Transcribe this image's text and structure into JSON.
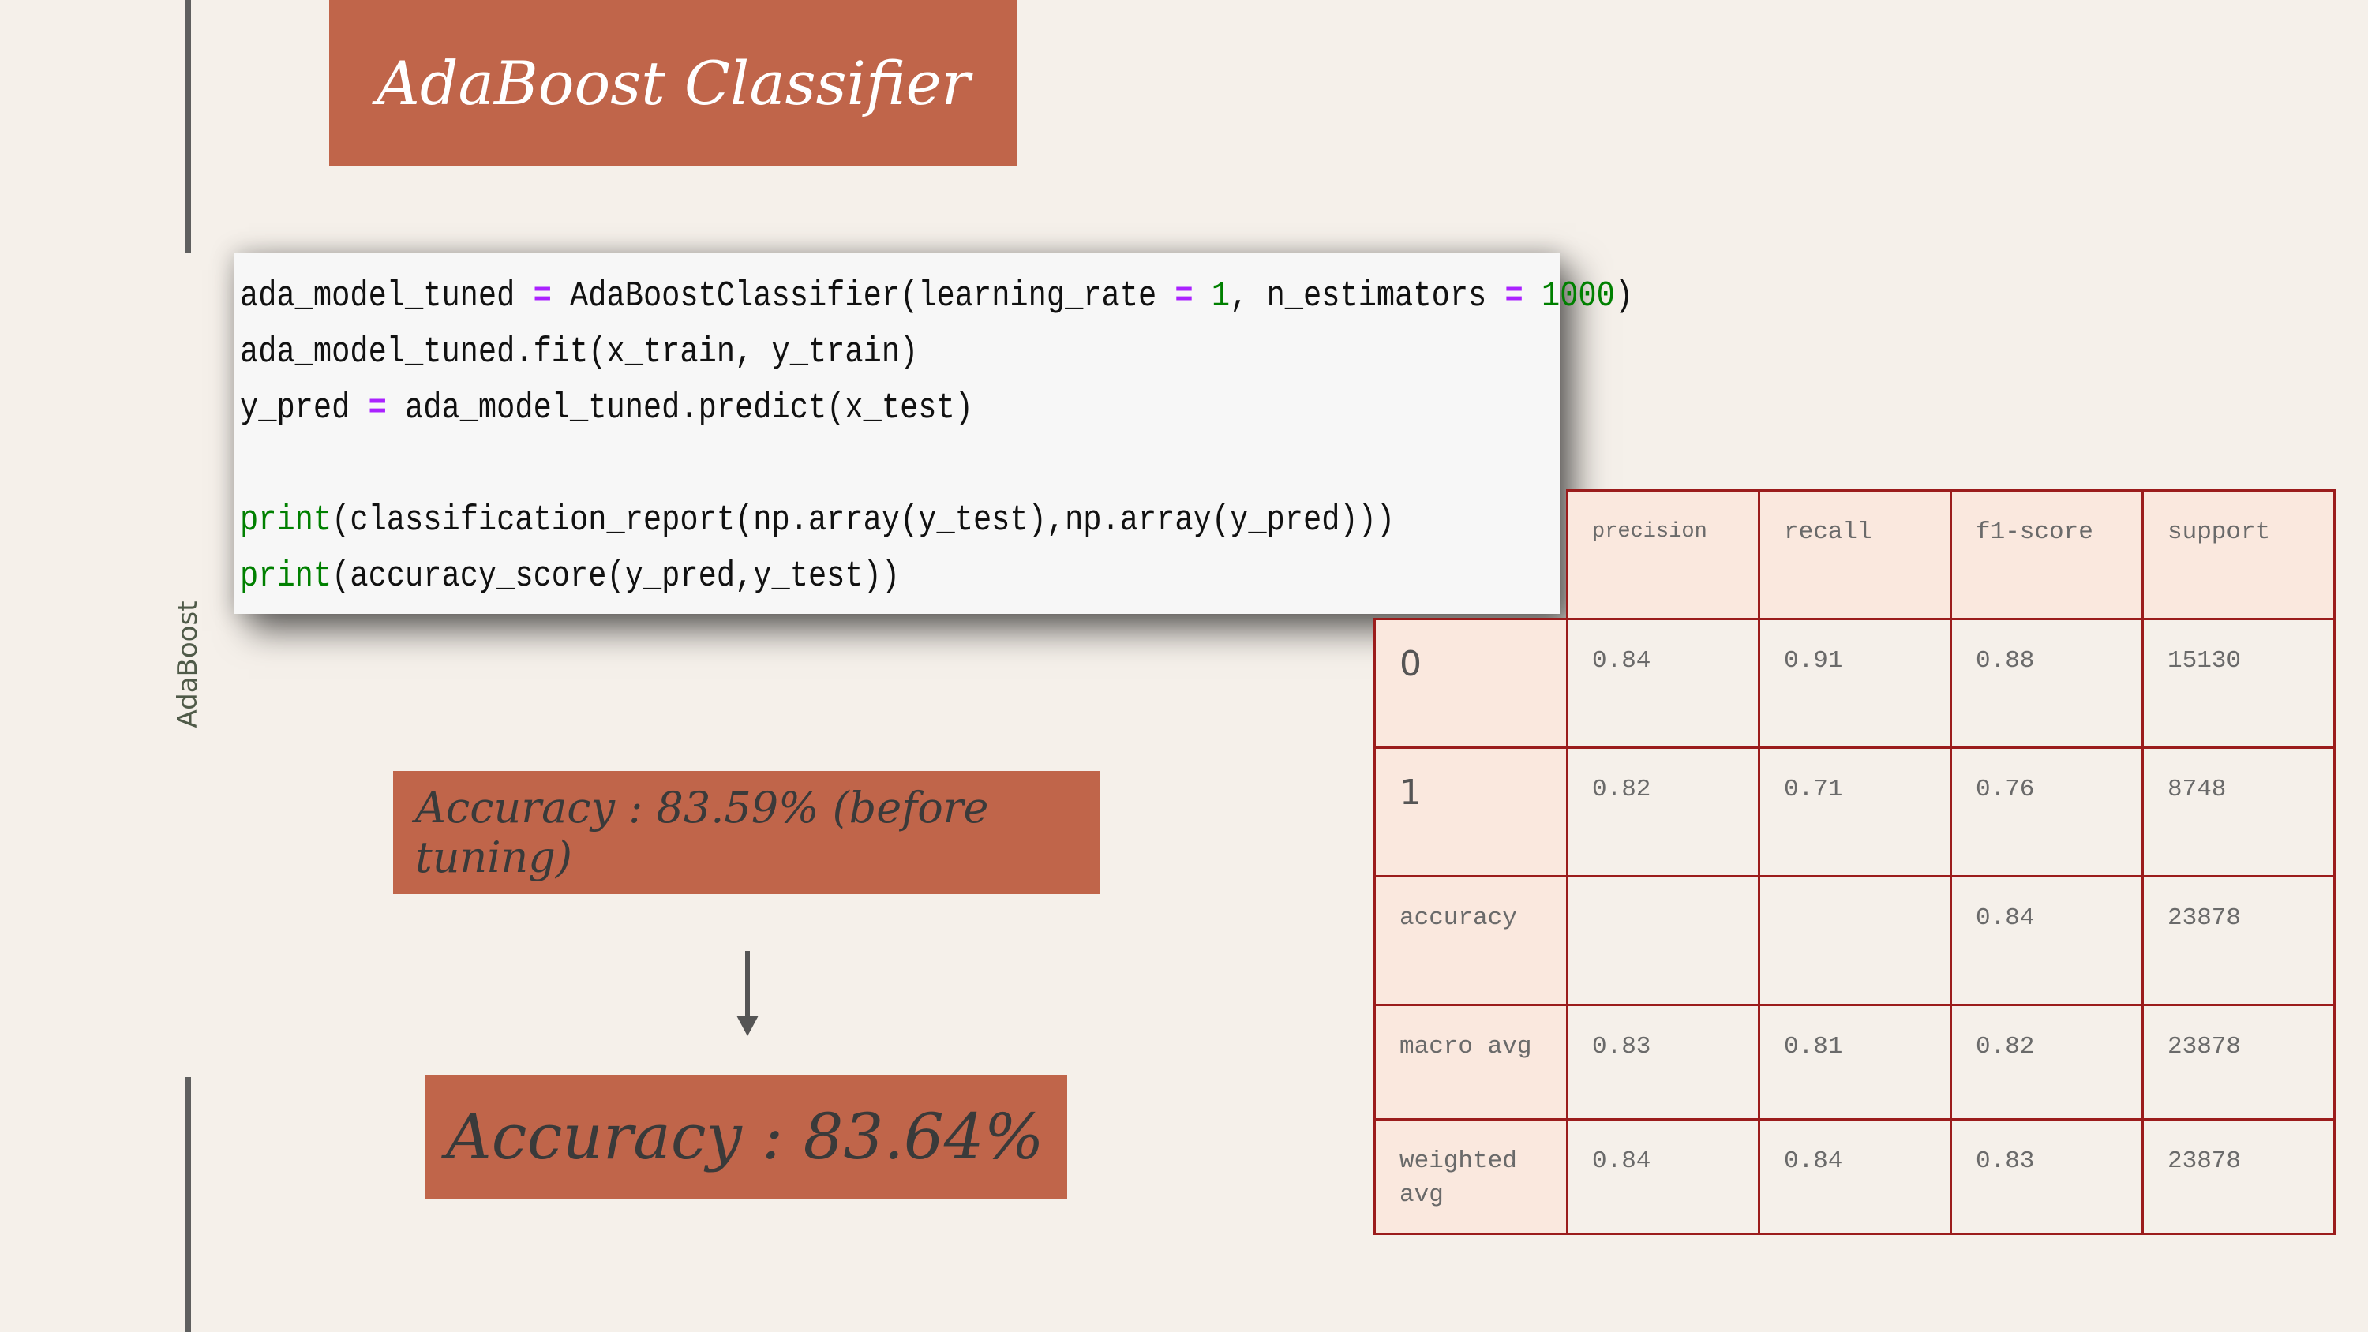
{
  "side_label": "AdaBoost",
  "title": "AdaBoost Classifier",
  "code": {
    "line1": {
      "a": "ada_model_tuned ",
      "op1": "=",
      "b": " AdaBoostClassifier(learning_rate ",
      "op2": "=",
      "c": " ",
      "num1": "1",
      "d": ", n_estimators ",
      "op3": "=",
      "e": " ",
      "num2": "1000",
      "f": ")"
    },
    "line2": "ada_model_tuned.fit(x_train, y_train)",
    "line3": {
      "a": "y_pred ",
      "op": "=",
      "b": " ada_model_tuned.predict(x_test)"
    },
    "line4": {
      "fn": "print",
      "rest": "(classification_report(np.array(y_test),np.array(y_pred)))"
    },
    "line5": {
      "fn": "print",
      "rest": "(accuracy_score(y_pred,y_test))"
    }
  },
  "accuracy_before": "Accuracy : 83.59% (before tuning)",
  "accuracy_after": "Accuracy : 83.64%",
  "report": {
    "headers": [
      "precision",
      "recall",
      "f1-score",
      "support"
    ],
    "rows": [
      {
        "label": "0",
        "precision": "0.84",
        "recall": "0.91",
        "f1": "0.88",
        "support": "15130"
      },
      {
        "label": "1",
        "precision": "0.82",
        "recall": "0.71",
        "f1": "0.76",
        "support": "8748"
      },
      {
        "label": "accuracy",
        "precision": "",
        "recall": "",
        "f1": "0.84",
        "support": "23878"
      },
      {
        "label": "macro avg",
        "precision": "0.83",
        "recall": "0.81",
        "f1": "0.82",
        "support": "23878"
      },
      {
        "label": "weighted avg",
        "precision": "0.84",
        "recall": "0.84",
        "f1": "0.83",
        "support": "23878"
      }
    ]
  },
  "colors": {
    "accent": "#c0654a",
    "background": "#f5f0ea",
    "table_border": "#9b1c1c",
    "table_shade": "#fae8de",
    "code_operator": "#aa22ff",
    "code_number": "#008000"
  },
  "icons": {
    "arrow": "arrow-down-icon"
  }
}
